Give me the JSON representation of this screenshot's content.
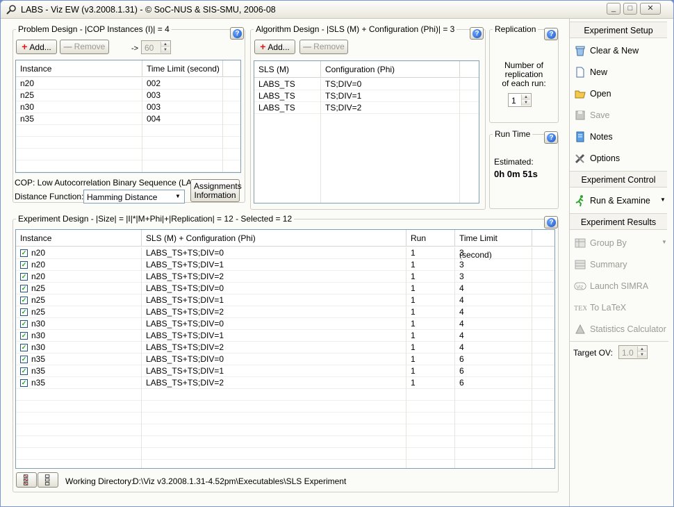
{
  "window": {
    "title": "LABS - Viz EW (v3.2008.1.31) - © SoC-NUS & SIS-SMU, 2006-08",
    "min": "_",
    "max": "□",
    "close": "✕"
  },
  "problem": {
    "title": "Problem Design - |COP Instances (I)| = 4",
    "add_label": "Add...",
    "remove_label": "Remove",
    "arrow_label": "->",
    "limit_value": "60",
    "columns": [
      "Instance",
      "Time Limit (second)"
    ],
    "rows": [
      {
        "instance": "n20",
        "limit": "002"
      },
      {
        "instance": "n25",
        "limit": "003"
      },
      {
        "instance": "n30",
        "limit": "003"
      },
      {
        "instance": "n35",
        "limit": "004"
      }
    ],
    "cop_label": "COP: Low Autocorrelation Binary Sequence (LABS)",
    "distance_label": "Distance Function:",
    "distance_value": "Hamming Distance",
    "assign_line1": "Assignments",
    "assign_line2": "Information"
  },
  "algorithm": {
    "title": "Algorithm Design - |SLS (M) + Configuration (Phi)| = 3",
    "add_label": "Add...",
    "remove_label": "Remove",
    "columns": [
      "SLS (M)",
      "Configuration (Phi)"
    ],
    "rows": [
      {
        "sls": "LABS_TS",
        "config": "TS;DIV=0"
      },
      {
        "sls": "LABS_TS",
        "config": "TS;DIV=1"
      },
      {
        "sls": "LABS_TS",
        "config": "TS;DIV=2"
      }
    ]
  },
  "replication": {
    "title": "Replication",
    "line1": "Number of",
    "line2": "replication",
    "line3": "of each run:",
    "value": "1"
  },
  "runtime": {
    "title": "Run Time",
    "estimated_label": "Estimated:",
    "value": "0h 0m 51s"
  },
  "experiment": {
    "title": "Experiment Design - |Size| = |I|*|M+Phi|+|Replication| = 12 - Selected = 12",
    "columns": [
      "Instance",
      "SLS (M) + Configuration (Phi)",
      "Run",
      "Time Limit (second)"
    ],
    "rows": [
      {
        "instance": "n20",
        "config": "LABS_TS+TS;DIV=0",
        "run": "1",
        "limit": "3"
      },
      {
        "instance": "n20",
        "config": "LABS_TS+TS;DIV=1",
        "run": "1",
        "limit": "3"
      },
      {
        "instance": "n20",
        "config": "LABS_TS+TS;DIV=2",
        "run": "1",
        "limit": "3"
      },
      {
        "instance": "n25",
        "config": "LABS_TS+TS;DIV=0",
        "run": "1",
        "limit": "4"
      },
      {
        "instance": "n25",
        "config": "LABS_TS+TS;DIV=1",
        "run": "1",
        "limit": "4"
      },
      {
        "instance": "n25",
        "config": "LABS_TS+TS;DIV=2",
        "run": "1",
        "limit": "4"
      },
      {
        "instance": "n30",
        "config": "LABS_TS+TS;DIV=0",
        "run": "1",
        "limit": "4"
      },
      {
        "instance": "n30",
        "config": "LABS_TS+TS;DIV=1",
        "run": "1",
        "limit": "4"
      },
      {
        "instance": "n30",
        "config": "LABS_TS+TS;DIV=2",
        "run": "1",
        "limit": "4"
      },
      {
        "instance": "n35",
        "config": "LABS_TS+TS;DIV=0",
        "run": "1",
        "limit": "6"
      },
      {
        "instance": "n35",
        "config": "LABS_TS+TS;DIV=1",
        "run": "1",
        "limit": "6"
      },
      {
        "instance": "n35",
        "config": "LABS_TS+TS;DIV=2",
        "run": "1",
        "limit": "6"
      }
    ],
    "working_dir_label": "Working Directory:",
    "working_dir_value": "D:\\Viz v3.2008.1.31-4.52pm\\Executables\\SLS Experiment"
  },
  "sidebar": {
    "setup_header": "Experiment Setup",
    "clear_new": "Clear & New",
    "new": "New",
    "open": "Open",
    "save": "Save",
    "notes": "Notes",
    "options": "Options",
    "control_header": "Experiment Control",
    "run_examine": "Run & Examine",
    "results_header": "Experiment Results",
    "group_by": "Group By",
    "summary": "Summary",
    "launch_simra": "Launch SIMRA",
    "to_latex": "To LaTeX",
    "stats_calc": "Statistics Calculator",
    "target_label": "Target OV:",
    "target_value": "1.0"
  }
}
